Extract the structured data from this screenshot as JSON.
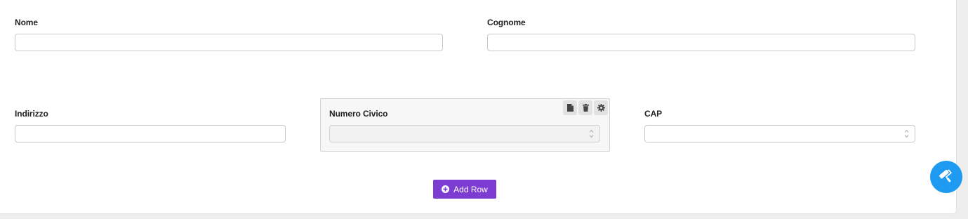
{
  "form": {
    "nome": {
      "label": "Nome",
      "value": ""
    },
    "cognome": {
      "label": "Cognome",
      "value": ""
    },
    "indirizzo": {
      "label": "Indirizzo",
      "value": ""
    },
    "numero_civico": {
      "label": "Numero Civico",
      "value": ""
    },
    "cap": {
      "label": "CAP",
      "value": ""
    }
  },
  "component_tools": [
    "copy-icon",
    "trash-icon",
    "gear-icon"
  ],
  "add_row": {
    "label": "Add Row",
    "icon": "plus-circle-icon"
  },
  "fab": {
    "icon": "paint-roller-icon"
  },
  "colors": {
    "accent_purple": "#7c3bd1",
    "fab_blue": "#1e9bf0"
  }
}
